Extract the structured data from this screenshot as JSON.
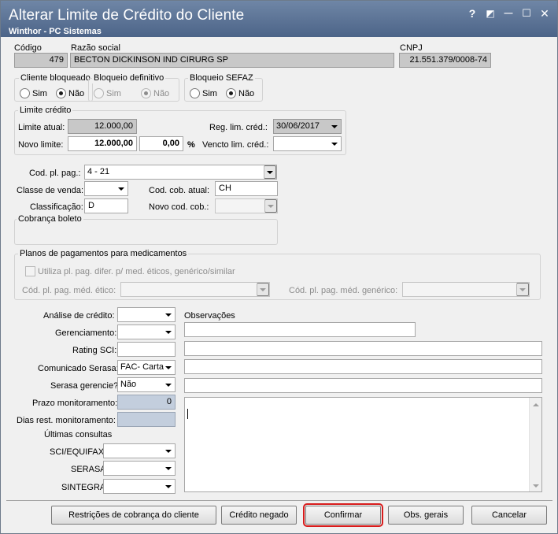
{
  "window": {
    "title": "Alterar Limite de Crédito do Cliente",
    "subtitle": "Winthor - PC Sistemas",
    "controls": [
      "?",
      "◩",
      "—",
      "☐",
      "✕"
    ]
  },
  "header": {
    "codigo_label": "Código",
    "codigo_value": "479",
    "razao_label": "Razão social",
    "razao_value": "BECTON DICKINSON IND CIRURG SP",
    "cnpj_label": "CNPJ",
    "cnpj_value": "21.551.379/0008-74"
  },
  "cliente_bloqueado": {
    "title": "Cliente bloqueado",
    "sim": "Sim",
    "nao": "Não",
    "selected": "nao"
  },
  "bloqueio_definitivo": {
    "title": "Bloqueio definitivo",
    "sim": "Sim",
    "nao": "Não",
    "selected": "nao"
  },
  "bloqueio_sefaz": {
    "title": "Bloqueio SEFAZ",
    "sim": "Sim",
    "nao": "Não",
    "selected": "nao"
  },
  "limite": {
    "title": "Limite crédito",
    "atual_label": "Limite atual:",
    "atual_value": "12.000,00",
    "novo_label": "Novo limite:",
    "novo_value": "12.000,00",
    "percent_value": "0,00",
    "percent_sign": "%",
    "reg_label": "Reg. lim. créd.:",
    "reg_value": "30/06/2017",
    "vencto_label": "Vencto lim. créd.:",
    "vencto_value": ""
  },
  "pagamento": {
    "cod_pl_pag_label": "Cod. pl. pag.:",
    "cod_pl_pag_value": "4 - 21",
    "classe_venda_label": "Classe de venda:",
    "classe_venda_value": "",
    "cod_cob_atual_label": "Cod. cob. atual:",
    "cod_cob_atual_value": "CH",
    "classificacao_label": "Classificação:",
    "classificacao_value": "D",
    "novo_cod_cob_label": "Novo cod. cob.:",
    "novo_cod_cob_value": "",
    "cobranca_boleto_title": "Cobrança boleto"
  },
  "medicamentos": {
    "title": "Planos de pagamentos para medicamentos",
    "checkbox_label": "Utiliza pl. pag. difer. p/ med. éticos, genérico/similar",
    "etico_label": "Cód. pl. pag. méd. ético:",
    "generico_label": "Cód. pl. pag. méd. genérico:"
  },
  "credito": {
    "analise_label": "Análise de crédito:",
    "analise_value": "",
    "gerenciamento_label": "Gerenciamento:",
    "gerenciamento_value": "",
    "rating_label": "Rating SCI:",
    "rating_value": "",
    "comunicado_label": "Comunicado Serasa:",
    "comunicado_value": "FAC- Carta",
    "serasa_gerencie_label": "Serasa gerencie?",
    "serasa_gerencie_value": "Não",
    "prazo_label": "Prazo monitoramento:",
    "prazo_value": "0",
    "dias_label": "Dias rest. monitoramento:",
    "dias_value": "",
    "ultimas_title": "Últimas consultas",
    "sci_label": "SCI/EQUIFAX",
    "serasa_label": "SERASA",
    "sintegra_label": "SINTEGRA",
    "observacoes_label": "Observações"
  },
  "buttons": {
    "restricoes": "Restrições de cobrança do cliente",
    "credito_negado": "Crédito negado",
    "confirmar": "Confirmar",
    "obs_gerais": "Obs. gerais",
    "cancelar": "Cancelar"
  }
}
